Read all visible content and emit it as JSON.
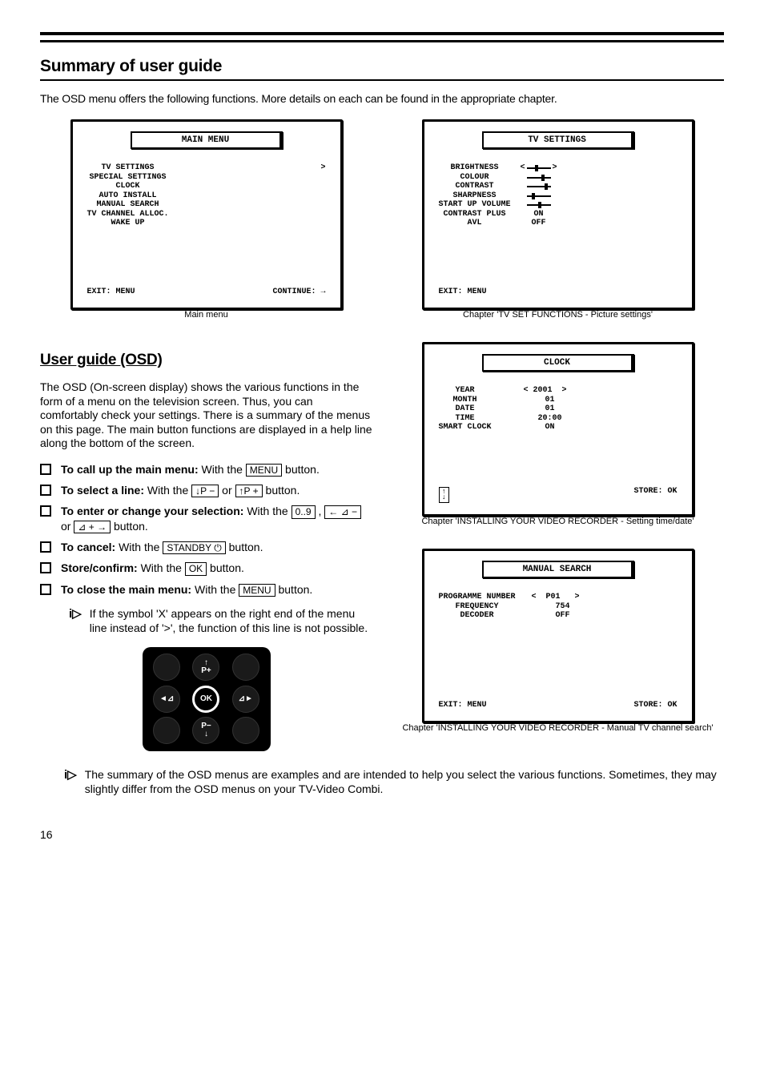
{
  "page_title": "Summary of user guide",
  "intro_text": "The OSD menu offers the following functions. More details on each can be found in the appropriate chapter.",
  "screens": {
    "main_menu": {
      "title": "MAIN MENU",
      "items": [
        "TV SETTINGS",
        "SPECIAL SETTINGS",
        "CLOCK",
        "AUTO INSTALL",
        "MANUAL SEARCH",
        "TV CHANNEL ALLOC.",
        "WAKE UP"
      ],
      "cursor": ">",
      "footer_left": "EXIT: MENU",
      "footer_right": "CONTINUE: →",
      "caption": "Main menu"
    },
    "tv_settings": {
      "title": "TV SETTINGS",
      "rows": [
        {
          "label": "BRIGHTNESS",
          "val": ""
        },
        {
          "label": "COLOUR",
          "val": ""
        },
        {
          "label": "CONTRAST",
          "val": ""
        },
        {
          "label": "SHARPNESS",
          "val": ""
        },
        {
          "label": "START UP VOLUME",
          "val": ""
        },
        {
          "label": "CONTRAST PLUS",
          "val": "ON"
        },
        {
          "label": "AVL",
          "val": "OFF"
        }
      ],
      "cursor_left": "<",
      "cursor_right": ">",
      "footer_left": "EXIT: MENU",
      "caption": "Chapter 'TV SET FUNCTIONS - Picture settings'"
    },
    "clock": {
      "title": "CLOCK",
      "rows": [
        {
          "label": "YEAR",
          "val": "2001"
        },
        {
          "label": "MONTH",
          "val": "01"
        },
        {
          "label": "DATE",
          "val": "01"
        },
        {
          "label": "TIME",
          "val": "20:00"
        },
        {
          "label": "SMART CLOCK",
          "val": "ON"
        }
      ],
      "cursor_left": "<",
      "cursor_right": ">",
      "footer_right": "STORE: OK",
      "caption": "Chapter 'INSTALLING YOUR VIDEO RECORDER - Setting time/date'"
    },
    "manual_search": {
      "title": "MANUAL SEARCH",
      "rows": [
        {
          "label": "PROGRAMME NUMBER",
          "val": "P01"
        },
        {
          "label": "FREQUENCY",
          "val": "754"
        },
        {
          "label": "DECODER",
          "val": "OFF"
        }
      ],
      "cursor_left": "<",
      "cursor_right": ">",
      "footer_left": "EXIT: MENU",
      "footer_right": "STORE: OK",
      "caption": "Chapter 'INSTALLING YOUR VIDEO RECORDER - Manual TV channel search'"
    }
  },
  "user_guide": {
    "heading": "User guide (OSD)",
    "para": "The OSD (On-screen display) shows the various functions in the form of a menu on the television screen. Thus, you can comfortably check your settings. There is a summary of the menus on this page. The main button functions are displayed in a help line along the bottom of the screen.",
    "items": [
      {
        "strong": "To call up the main menu:",
        "rest": " With the ",
        "key": "MENU",
        "tail": " button."
      },
      {
        "strong": "To select a line:",
        "rest": " With the ",
        "key": "↓P −",
        "mid": " or ",
        "key2": "↑P +",
        "tail": " button."
      },
      {
        "strong": "To enter or change your selection:",
        "rest": " With the ",
        "key": "0..9",
        "mid": " , ",
        "key2": "← ⊿ −",
        "mid2": " or ",
        "key3": "⊿ + →",
        "tail": " button."
      },
      {
        "strong": "To cancel:",
        "rest": " With the ",
        "key": "STANDBY ⏻",
        "tail": " button."
      },
      {
        "strong": "Store/confirm:",
        "rest": " With the ",
        "key": "OK",
        "tail": " button."
      },
      {
        "strong": "To close the main menu:",
        "rest": " With the ",
        "key": "MENU",
        "tail": " button."
      }
    ],
    "note": "If the symbol 'X' appears on the right end of the menu line instead of '>', the function of this line is not possible."
  },
  "remote": {
    "up": "↑\nP+",
    "down": "P−\n↓",
    "left": "◄⊿",
    "right": "⊿►",
    "ok": "OK"
  },
  "footer_note": "The summary of the OSD menus are examples and are intended to help you select the various functions. Sometimes, they may slightly differ from the OSD menus on your TV-Video Combi.",
  "info_icon": "i▷",
  "page_number": "16"
}
